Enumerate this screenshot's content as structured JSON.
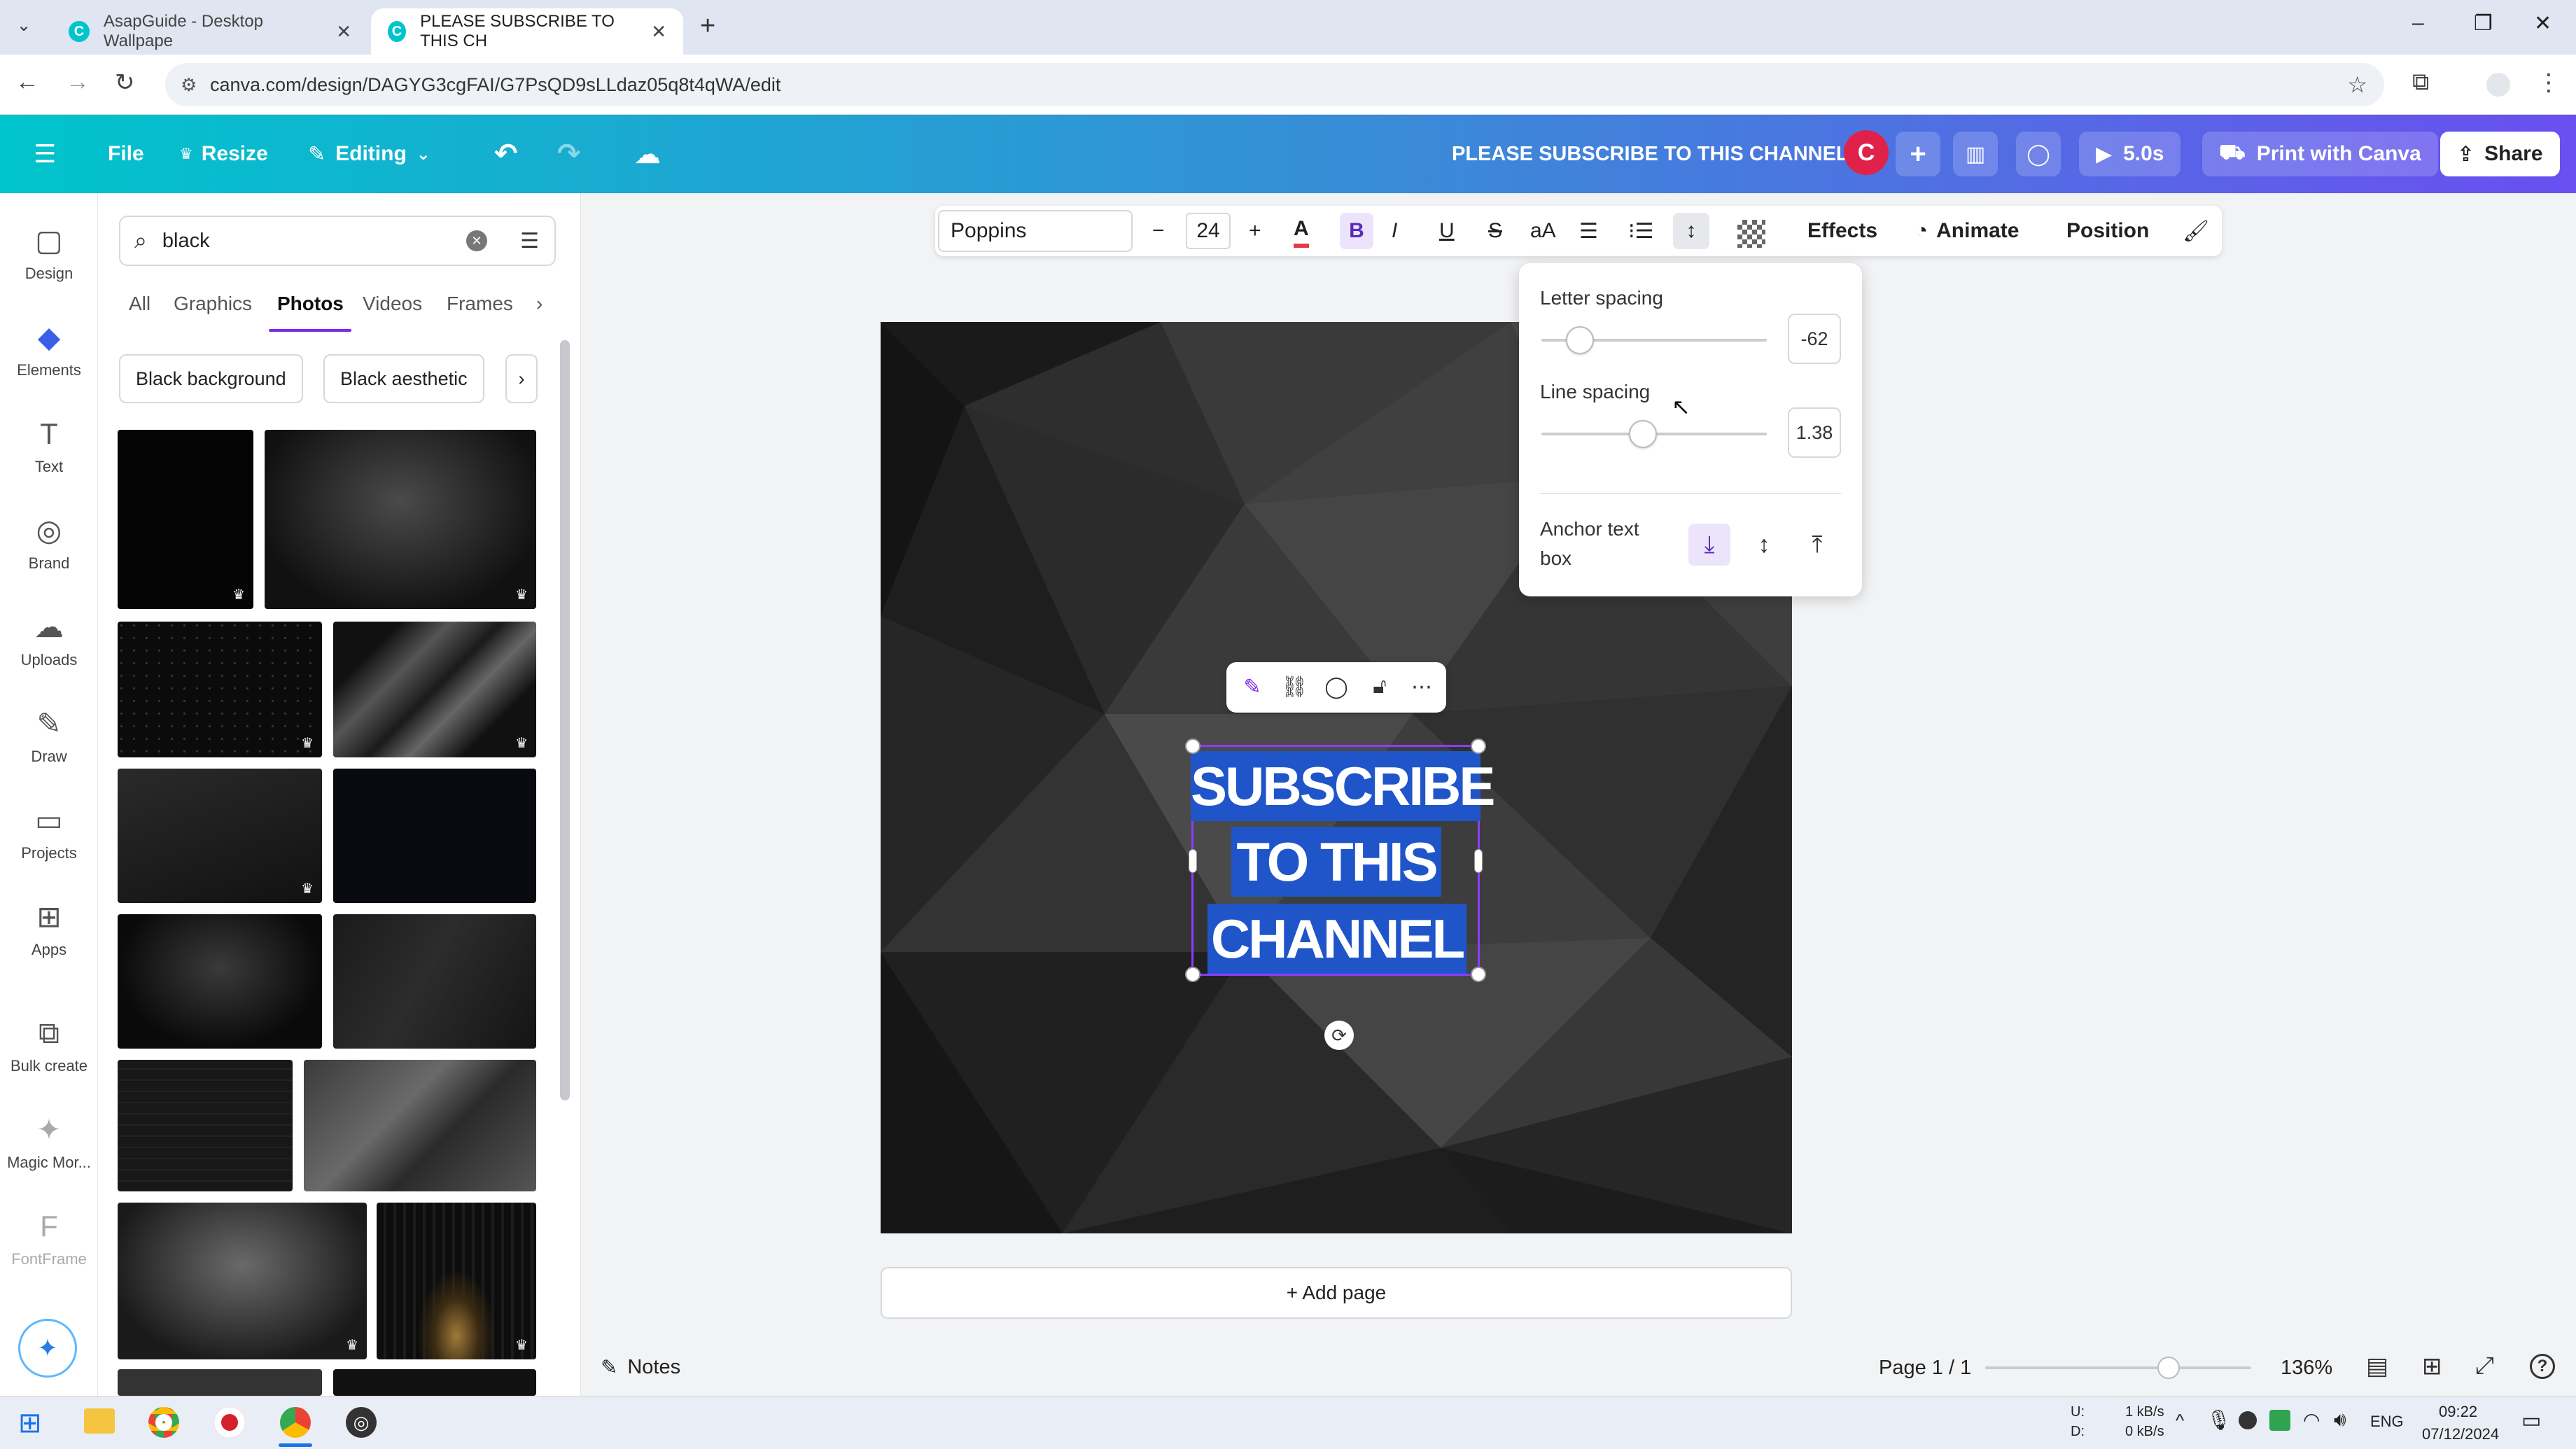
{
  "browser": {
    "tabs": [
      {
        "title": "AsapGuide - Desktop Wallpape",
        "active": false
      },
      {
        "title": "PLEASE SUBSCRIBE TO THIS CH",
        "active": true
      }
    ],
    "new_tab": "+",
    "url": "canva.com/design/DAGYG3cgFAI/G7PsQD9sLLdaz05q8t4qWA/edit",
    "window_buttons": {
      "minimize": "–",
      "restore": "❐",
      "close": "✕"
    }
  },
  "header": {
    "menu_icon": "☰",
    "file": "File",
    "resize": "Resize",
    "editing": "Editing",
    "design_title": "PLEASE SUBSCRIBE TO THIS CHANNEL",
    "avatar_letter": "C",
    "play_duration": "5.0s",
    "print_label": "Print with Canva",
    "share_label": "Share"
  },
  "rail": [
    {
      "label": "Design",
      "icon": "▢"
    },
    {
      "label": "Elements",
      "icon": "◆"
    },
    {
      "label": "Text",
      "icon": "T"
    },
    {
      "label": "Brand",
      "icon": "◎"
    },
    {
      "label": "Uploads",
      "icon": "☁"
    },
    {
      "label": "Draw",
      "icon": "✎"
    },
    {
      "label": "Projects",
      "icon": "▭"
    },
    {
      "label": "Apps",
      "icon": "⊞"
    },
    {
      "label": "Bulk create",
      "icon": "⧉"
    },
    {
      "label": "Magic Mor...",
      "icon": "✦"
    },
    {
      "label": "FontFrame",
      "icon": "F"
    }
  ],
  "panel": {
    "search_value": "black",
    "tabs": [
      "All",
      "Graphics",
      "Photos",
      "Videos",
      "Frames"
    ],
    "active_tab": "Photos",
    "chips": [
      "Black background",
      "Black aesthetic"
    ]
  },
  "text_toolbar": {
    "font": "Poppins",
    "font_size": "24",
    "effects": "Effects",
    "animate": "Animate",
    "position": "Position"
  },
  "spacing_popup": {
    "letter_spacing_label": "Letter spacing",
    "letter_spacing_value": "-62",
    "letter_spacing_level": 0.17,
    "line_spacing_label": "Line spacing",
    "line_spacing_value": "1.38",
    "line_spacing_level": 0.45,
    "anchor_label_1": "Anchor text",
    "anchor_label_2": "box"
  },
  "canvas": {
    "text_lines": [
      "SUBSCRIBE",
      "TO THIS",
      "CHANNEL"
    ],
    "add_page": "+ Add page"
  },
  "status": {
    "notes": "Notes",
    "page": "Page 1 / 1",
    "zoom": "136%",
    "zoom_level": 0.69
  },
  "taskbar": {
    "net_up": "1 kB/s",
    "net_down": "0 kB/s",
    "net_u_label": "U:",
    "net_d_label": "D:",
    "lang": "ENG",
    "time": "09:22",
    "date": "07/12/2024"
  }
}
